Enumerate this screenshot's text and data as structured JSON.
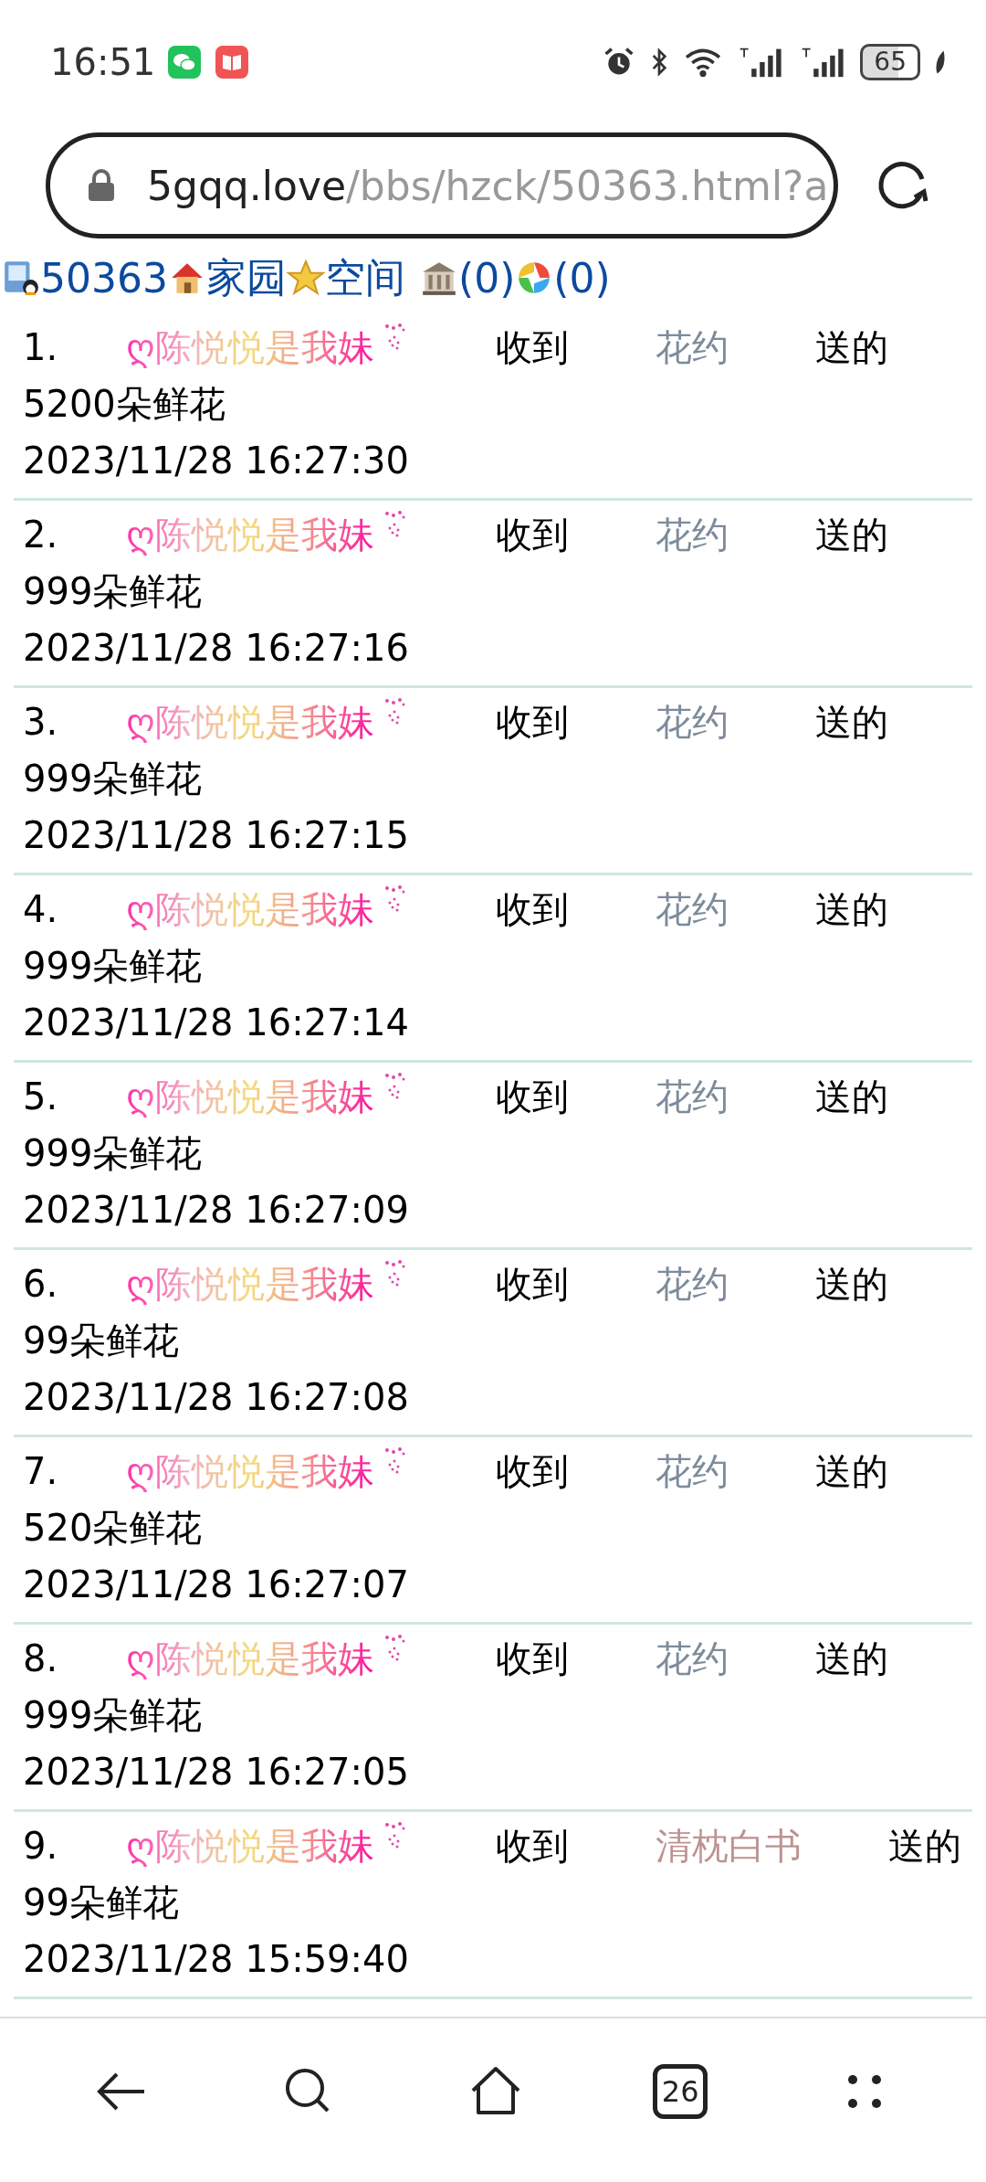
{
  "status_bar": {
    "time": "16:51",
    "battery": "65"
  },
  "address_bar": {
    "domain": "5gqq.love",
    "path": "/bbs/hzck/50363.html?a"
  },
  "header_links": [
    {
      "kind": "id",
      "label": "50363"
    },
    {
      "kind": "home",
      "label": "家园"
    },
    {
      "kind": "space",
      "label": "空间"
    },
    {
      "kind": "bank",
      "label": "(0)"
    },
    {
      "kind": "album",
      "label": "(0)"
    }
  ],
  "records": [
    {
      "number": "1.",
      "recipient": "ღ陈悦悦是我妹",
      "verb": "收到",
      "giver": "花约",
      "color": "#7d8b9b",
      "sent": "送的",
      "gift": "5200朵鲜花",
      "time": "2023/11/28 16:27:30"
    },
    {
      "number": "2.",
      "recipient": "ღ陈悦悦是我妹",
      "verb": "收到",
      "giver": "花约",
      "color": "#7d8b9b",
      "sent": "送的",
      "gift": "999朵鲜花",
      "time": "2023/11/28 16:27:16"
    },
    {
      "number": "3.",
      "recipient": "ღ陈悦悦是我妹",
      "verb": "收到",
      "giver": "花约",
      "color": "#7d8b9b",
      "sent": "送的",
      "gift": "999朵鲜花",
      "time": "2023/11/28 16:27:15"
    },
    {
      "number": "4.",
      "recipient": "ღ陈悦悦是我妹",
      "verb": "收到",
      "giver": "花约",
      "color": "#7d8b9b",
      "sent": "送的",
      "gift": "999朵鲜花",
      "time": "2023/11/28 16:27:14"
    },
    {
      "number": "5.",
      "recipient": "ღ陈悦悦是我妹",
      "verb": "收到",
      "giver": "花约",
      "color": "#7d8b9b",
      "sent": "送的",
      "gift": "999朵鲜花",
      "time": "2023/11/28 16:27:09"
    },
    {
      "number": "6.",
      "recipient": "ღ陈悦悦是我妹",
      "verb": "收到",
      "giver": "花约",
      "color": "#7d8b9b",
      "sent": "送的",
      "gift": "99朵鲜花",
      "time": "2023/11/28 16:27:08"
    },
    {
      "number": "7.",
      "recipient": "ღ陈悦悦是我妹",
      "verb": "收到",
      "giver": "花约",
      "color": "#7d8b9b",
      "sent": "送的",
      "gift": "520朵鲜花",
      "time": "2023/11/28 16:27:07"
    },
    {
      "number": "8.",
      "recipient": "ღ陈悦悦是我妹",
      "verb": "收到",
      "giver": "花约",
      "color": "#7d8b9b",
      "sent": "送的",
      "gift": "999朵鲜花",
      "time": "2023/11/28 16:27:05"
    },
    {
      "number": "9.",
      "recipient": "ღ陈悦悦是我妹",
      "verb": "收到",
      "giver": "清枕白书",
      "color": "#bc9391",
      "sent": "送的",
      "gift": "99朵鲜花",
      "time": "2023/11/28 15:59:40"
    }
  ],
  "nav_bar": {
    "tab_count": "26"
  }
}
